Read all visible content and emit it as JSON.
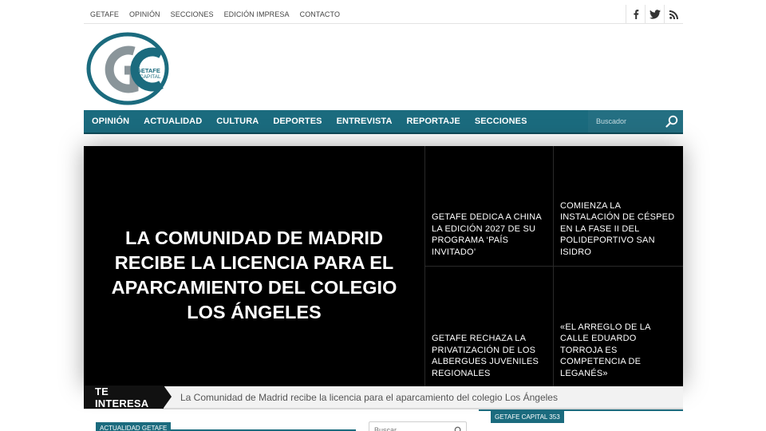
{
  "top_nav": {
    "items": [
      "GETAFE",
      "OPINIÓN",
      "SECCIONES",
      "EDICIÓN IMPRESA",
      "CONTACTO"
    ]
  },
  "social": {
    "icons": [
      "facebook-icon",
      "twitter-icon",
      "rss-icon"
    ]
  },
  "logo": {
    "text_line1": "GETAFE",
    "text_line2": "CAPITAL",
    "brand_color": "#1b6b7e",
    "secondary_color": "#8a959a"
  },
  "main_nav": {
    "items": [
      "OPINIÓN",
      "ACTUALIDAD",
      "CULTURA",
      "DEPORTES",
      "ENTREVISTA",
      "REPORTAJE",
      "SECCIONES"
    ],
    "search_placeholder": "Buscador",
    "background_color": "#1b6b7e"
  },
  "featured": {
    "main_headline": "LA COMUNIDAD DE MADRID RECIBE LA LICENCIA PARA EL APARCAMIENTO DEL COLEGIO LOS ÁNGELES",
    "tiles": [
      "GETAFE DEDICA A CHINA LA EDICIÓN 2027 DE SU PROGRAMA ‘PAÍS INVITADO’",
      "COMIENZA LA INSTALACIÓN DE CÉSPED EN LA FASE II DEL POLIDEPORTIVO SAN ISIDRO",
      "GETAFE RECHAZA LA PRIVATIZACIÓN DE LOS ALBERGUES JUVENILES REGIONALES",
      "«EL ARREGLO DE LA CALLE EDUARDO TORROJA ES COMPETENCIA DE LEGANÉS»"
    ]
  },
  "ticker": {
    "label": "TE INTERESA",
    "text": "La Comunidad de Madrid recibe la licencia para el aparcamiento del colegio Los Ángeles"
  },
  "below": {
    "left_badge": "ACTUALIDAD GETAFE",
    "right_badge": "GETAFE CAPITAL 353",
    "search_placeholder": "Buscar..."
  }
}
